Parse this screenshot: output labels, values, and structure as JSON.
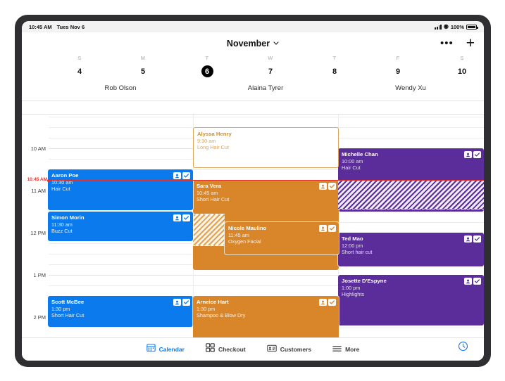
{
  "status_bar": {
    "time": "10:45 AM",
    "date": "Tues Nov 6",
    "battery_percent": "100%",
    "icons": [
      "cellular-signal-icon",
      "wifi-icon",
      "battery-icon"
    ]
  },
  "header": {
    "title": "November",
    "chevron": "⌄",
    "more_label": "•••",
    "add_label": "+"
  },
  "week": {
    "days": [
      {
        "dow": "S",
        "date": "4",
        "today": false
      },
      {
        "dow": "M",
        "date": "5",
        "today": false
      },
      {
        "dow": "T",
        "date": "6",
        "today": true
      },
      {
        "dow": "W",
        "date": "7",
        "today": false
      },
      {
        "dow": "T",
        "date": "8",
        "today": false
      },
      {
        "dow": "F",
        "date": "9",
        "today": false
      },
      {
        "dow": "S",
        "date": "10",
        "today": false
      }
    ]
  },
  "staff": [
    {
      "name": "Rob Olson",
      "color": "#0b7aec"
    },
    {
      "name": "Alaina Tyrer",
      "color": "#d9862a"
    },
    {
      "name": "Wendy Xu",
      "color": "#5b2d9a"
    }
  ],
  "time_axis": {
    "labels": [
      "10 AM",
      "11 AM",
      "12 PM",
      "1 PM",
      "2 PM"
    ],
    "current_time_label": "10:45 AM",
    "current_time_color": "#e4322b"
  },
  "appointments": [
    {
      "client": "Alyssa Henry",
      "time": "9:30 am",
      "service": "Long Hair Cut",
      "staff": "Alaina Tyrer",
      "style": "outline",
      "badges": []
    },
    {
      "client": "Michelle Chan",
      "time": "10:00 am",
      "service": "Hair Cut",
      "staff": "Wendy Xu",
      "style": "purple",
      "badges": [
        "add-person-icon",
        "check-icon"
      ]
    },
    {
      "client": "Aaron Poe",
      "time": "10:30 am",
      "service": "Hair Cut",
      "staff": "Rob Olson",
      "style": "blue",
      "badges": [
        "add-person-icon",
        "check-icon"
      ]
    },
    {
      "client": "Sara Vera",
      "time": "10:45 am",
      "service": "Short Hair Cut",
      "staff": "Alaina Tyrer",
      "style": "orange",
      "badges": [
        "add-person-icon",
        "check-icon"
      ]
    },
    {
      "client": "Simon Morin",
      "time": "11:30 am",
      "service": "Buzz Cut",
      "staff": "Rob Olson",
      "style": "blue",
      "badges": [
        "add-person-icon",
        "check-icon"
      ]
    },
    {
      "client": "Nicole Maulino",
      "time": "11:45 am",
      "service": "Oxygen Facial",
      "staff": "Alaina Tyrer",
      "style": "orange",
      "badges": [
        "add-person-icon",
        "check-icon"
      ]
    },
    {
      "client": "Ted Mao",
      "time": "12:00 pm",
      "service": "Short hair cut",
      "staff": "Wendy Xu",
      "style": "purple",
      "badges": [
        "add-person-icon",
        "check-icon"
      ]
    },
    {
      "client": "Josette D'Espyne",
      "time": "1:00 pm",
      "service": "Highlights",
      "staff": "Wendy Xu",
      "style": "purple",
      "badges": [
        "add-person-icon",
        "check-icon"
      ]
    },
    {
      "client": "Scott McBee",
      "time": "1:30 pm",
      "service": "Short Hair Cut",
      "staff": "Rob Olson",
      "style": "blue",
      "badges": [
        "add-person-icon",
        "check-icon"
      ]
    },
    {
      "client": "Arneice Hart",
      "time": "1:30 pm",
      "service": "Shampoo & Blow Dry",
      "staff": "Alaina Tyrer",
      "style": "orange",
      "badges": [
        "add-person-icon",
        "check-icon"
      ]
    }
  ],
  "tabs": [
    {
      "label": "Calendar",
      "icon": "calendar-icon",
      "active": true
    },
    {
      "label": "Checkout",
      "icon": "grid-icon",
      "active": false
    },
    {
      "label": "Customers",
      "icon": "contact-card-icon",
      "active": false
    },
    {
      "label": "More",
      "icon": "hamburger-icon",
      "active": false
    }
  ],
  "clock_button": {
    "icon": "clock-icon",
    "color": "#0b7aec"
  }
}
